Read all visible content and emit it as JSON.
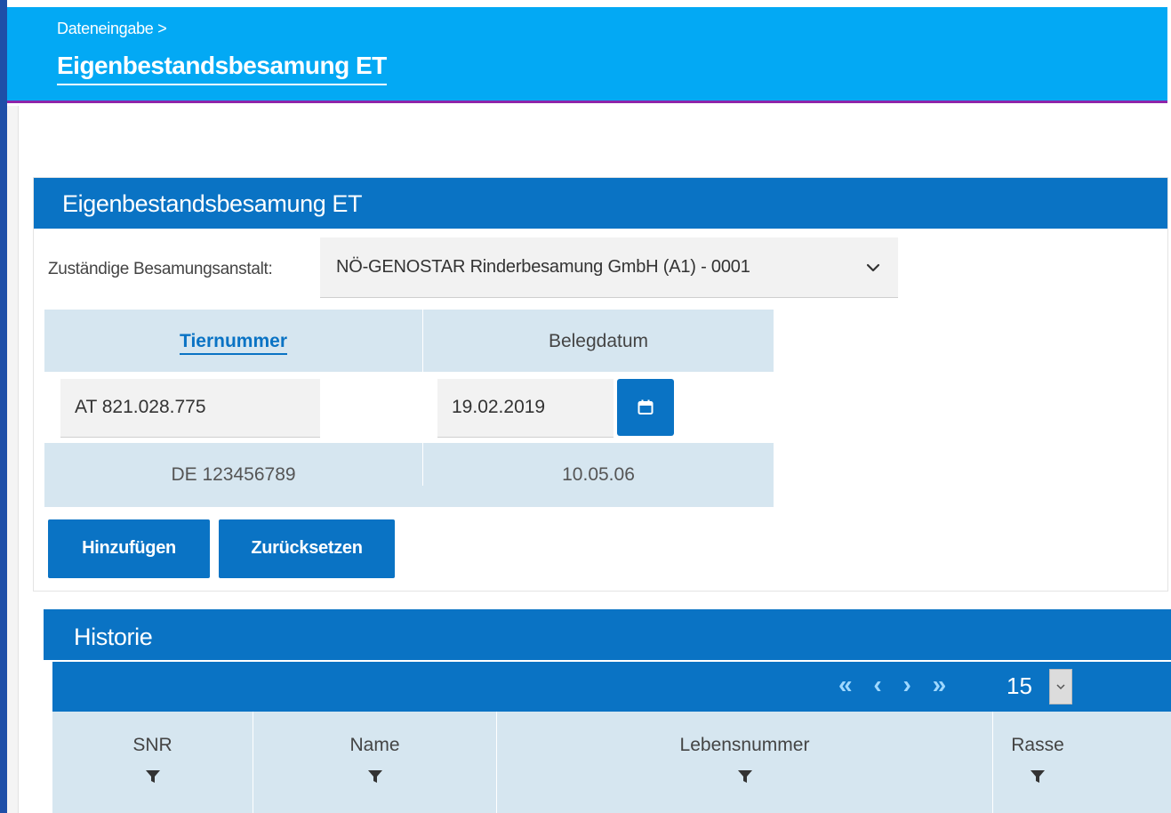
{
  "header": {
    "breadcrumb": "Dateneingabe >",
    "title": "Eigenbestandsbesamung ET"
  },
  "form_panel": {
    "title": "Eigenbestandsbesamung ET",
    "besamungsanstalt_label": "Zuständige Besamungsanstalt:",
    "besamungsanstalt_value": "NÖ-GENOSTAR Rinderbesamung GmbH (A1) - 0001",
    "table": {
      "col_tiernummer": "Tiernummer",
      "col_belegdatum": "Belegdatum",
      "tiernummer_value": "AT 821.028.775",
      "belegdatum_value": "19.02.2019",
      "example_tiernummer": "DE 123456789",
      "example_belegdatum": "10.05.06"
    },
    "buttons": {
      "add": "Hinzufügen",
      "reset": "Zurücksetzen"
    }
  },
  "historie": {
    "title": "Historie",
    "pager": {
      "page_size": "15"
    },
    "columns": [
      "SNR",
      "Name",
      "Lebensnummer",
      "Rasse"
    ]
  },
  "colors": {
    "header_bg": "#03a9f4",
    "panel_header_bg": "#0a73c4",
    "table_header_bg": "#d6e6f0",
    "accent_line": "#8e24aa"
  }
}
